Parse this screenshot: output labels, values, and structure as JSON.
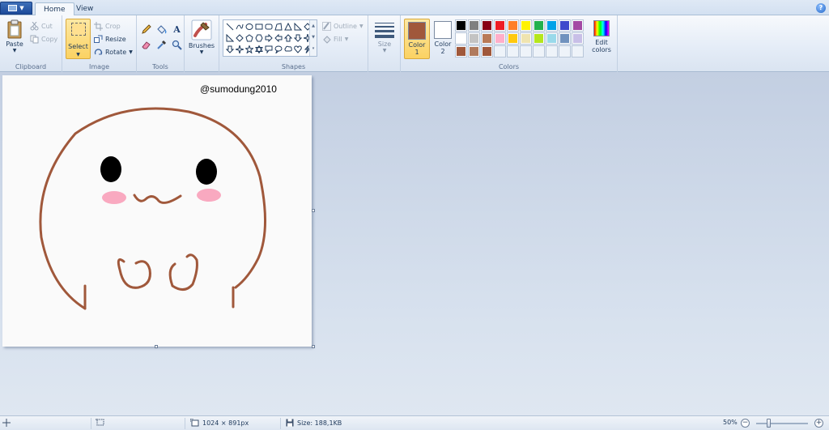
{
  "tabs": {
    "home": "Home",
    "view": "View"
  },
  "clipboard": {
    "paste": "Paste",
    "cut": "Cut",
    "copy": "Copy",
    "label": "Clipboard"
  },
  "image": {
    "select": "Select",
    "crop": "Crop",
    "resize": "Resize",
    "rotate": "Rotate",
    "label": "Image"
  },
  "tools": {
    "label": "Tools",
    "items": [
      "pencil-icon",
      "fill-bucket-icon",
      "text-icon",
      "eraser-icon",
      "color-picker-icon",
      "magnifier-icon"
    ]
  },
  "brushes": {
    "label": "Brushes"
  },
  "shapes": {
    "outline": "Outline",
    "fill": "Fill",
    "label": "Shapes"
  },
  "size": {
    "label": "Size"
  },
  "colors": {
    "color1_label": "Color",
    "color1_num": "1",
    "color2_label": "Color",
    "color2_num": "2",
    "edit_line1": "Edit",
    "edit_line2": "colors",
    "label": "Colors",
    "color1_value": "#a0583b",
    "color2_value": "#ffffff",
    "palette": [
      [
        "#000000",
        "#7f7f7f",
        "#880015",
        "#ed1c24",
        "#ff7f27",
        "#fff200",
        "#22b14c",
        "#00a2e8",
        "#3f48cc",
        "#a349a4"
      ],
      [
        "#ffffff",
        "#c3c3c3",
        "#b97a57",
        "#ffaec9",
        "#ffc90e",
        "#efe4b0",
        "#b5e61d",
        "#99d9ea",
        "#7092be",
        "#c8bfe7"
      ],
      [
        "#a0583b",
        "#b07a5d",
        "#a0583b",
        "",
        "",
        "",
        "",
        "",
        "",
        ""
      ]
    ]
  },
  "canvas": {
    "watermark": "@sumodung2010",
    "stroke_color": "#a0583b",
    "blush_color": "#f9a9c0"
  },
  "status": {
    "dimensions": "1024 × 891px",
    "size": "Size: 188,1KB",
    "zoom": "50%"
  }
}
